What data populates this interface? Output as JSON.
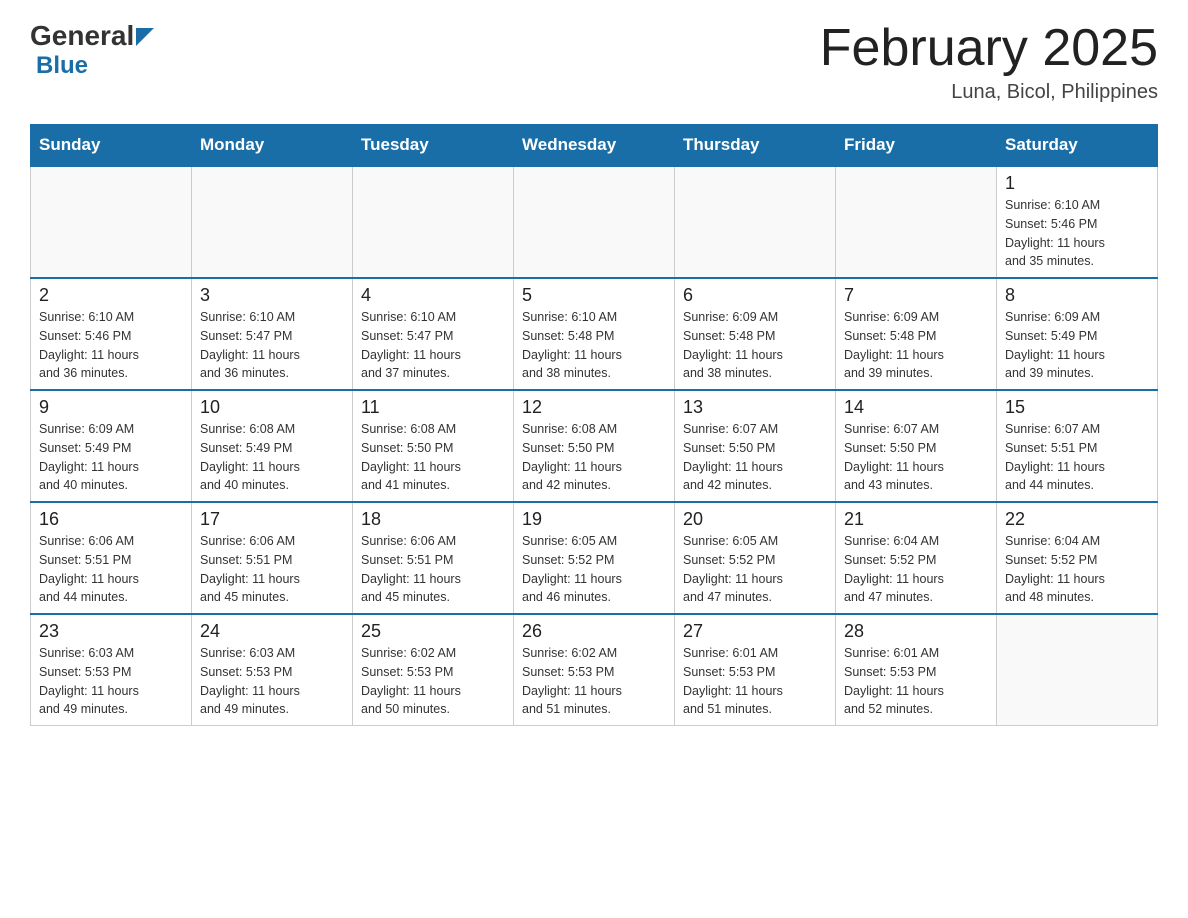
{
  "header": {
    "logo_general": "General",
    "logo_blue": "Blue",
    "title": "February 2025",
    "subtitle": "Luna, Bicol, Philippines"
  },
  "weekdays": [
    "Sunday",
    "Monday",
    "Tuesday",
    "Wednesday",
    "Thursday",
    "Friday",
    "Saturday"
  ],
  "weeks": [
    [
      {
        "day": "",
        "info": ""
      },
      {
        "day": "",
        "info": ""
      },
      {
        "day": "",
        "info": ""
      },
      {
        "day": "",
        "info": ""
      },
      {
        "day": "",
        "info": ""
      },
      {
        "day": "",
        "info": ""
      },
      {
        "day": "1",
        "info": "Sunrise: 6:10 AM\nSunset: 5:46 PM\nDaylight: 11 hours\nand 35 minutes."
      }
    ],
    [
      {
        "day": "2",
        "info": "Sunrise: 6:10 AM\nSunset: 5:46 PM\nDaylight: 11 hours\nand 36 minutes."
      },
      {
        "day": "3",
        "info": "Sunrise: 6:10 AM\nSunset: 5:47 PM\nDaylight: 11 hours\nand 36 minutes."
      },
      {
        "day": "4",
        "info": "Sunrise: 6:10 AM\nSunset: 5:47 PM\nDaylight: 11 hours\nand 37 minutes."
      },
      {
        "day": "5",
        "info": "Sunrise: 6:10 AM\nSunset: 5:48 PM\nDaylight: 11 hours\nand 38 minutes."
      },
      {
        "day": "6",
        "info": "Sunrise: 6:09 AM\nSunset: 5:48 PM\nDaylight: 11 hours\nand 38 minutes."
      },
      {
        "day": "7",
        "info": "Sunrise: 6:09 AM\nSunset: 5:48 PM\nDaylight: 11 hours\nand 39 minutes."
      },
      {
        "day": "8",
        "info": "Sunrise: 6:09 AM\nSunset: 5:49 PM\nDaylight: 11 hours\nand 39 minutes."
      }
    ],
    [
      {
        "day": "9",
        "info": "Sunrise: 6:09 AM\nSunset: 5:49 PM\nDaylight: 11 hours\nand 40 minutes."
      },
      {
        "day": "10",
        "info": "Sunrise: 6:08 AM\nSunset: 5:49 PM\nDaylight: 11 hours\nand 40 minutes."
      },
      {
        "day": "11",
        "info": "Sunrise: 6:08 AM\nSunset: 5:50 PM\nDaylight: 11 hours\nand 41 minutes."
      },
      {
        "day": "12",
        "info": "Sunrise: 6:08 AM\nSunset: 5:50 PM\nDaylight: 11 hours\nand 42 minutes."
      },
      {
        "day": "13",
        "info": "Sunrise: 6:07 AM\nSunset: 5:50 PM\nDaylight: 11 hours\nand 42 minutes."
      },
      {
        "day": "14",
        "info": "Sunrise: 6:07 AM\nSunset: 5:50 PM\nDaylight: 11 hours\nand 43 minutes."
      },
      {
        "day": "15",
        "info": "Sunrise: 6:07 AM\nSunset: 5:51 PM\nDaylight: 11 hours\nand 44 minutes."
      }
    ],
    [
      {
        "day": "16",
        "info": "Sunrise: 6:06 AM\nSunset: 5:51 PM\nDaylight: 11 hours\nand 44 minutes."
      },
      {
        "day": "17",
        "info": "Sunrise: 6:06 AM\nSunset: 5:51 PM\nDaylight: 11 hours\nand 45 minutes."
      },
      {
        "day": "18",
        "info": "Sunrise: 6:06 AM\nSunset: 5:51 PM\nDaylight: 11 hours\nand 45 minutes."
      },
      {
        "day": "19",
        "info": "Sunrise: 6:05 AM\nSunset: 5:52 PM\nDaylight: 11 hours\nand 46 minutes."
      },
      {
        "day": "20",
        "info": "Sunrise: 6:05 AM\nSunset: 5:52 PM\nDaylight: 11 hours\nand 47 minutes."
      },
      {
        "day": "21",
        "info": "Sunrise: 6:04 AM\nSunset: 5:52 PM\nDaylight: 11 hours\nand 47 minutes."
      },
      {
        "day": "22",
        "info": "Sunrise: 6:04 AM\nSunset: 5:52 PM\nDaylight: 11 hours\nand 48 minutes."
      }
    ],
    [
      {
        "day": "23",
        "info": "Sunrise: 6:03 AM\nSunset: 5:53 PM\nDaylight: 11 hours\nand 49 minutes."
      },
      {
        "day": "24",
        "info": "Sunrise: 6:03 AM\nSunset: 5:53 PM\nDaylight: 11 hours\nand 49 minutes."
      },
      {
        "day": "25",
        "info": "Sunrise: 6:02 AM\nSunset: 5:53 PM\nDaylight: 11 hours\nand 50 minutes."
      },
      {
        "day": "26",
        "info": "Sunrise: 6:02 AM\nSunset: 5:53 PM\nDaylight: 11 hours\nand 51 minutes."
      },
      {
        "day": "27",
        "info": "Sunrise: 6:01 AM\nSunset: 5:53 PM\nDaylight: 11 hours\nand 51 minutes."
      },
      {
        "day": "28",
        "info": "Sunrise: 6:01 AM\nSunset: 5:53 PM\nDaylight: 11 hours\nand 52 minutes."
      },
      {
        "day": "",
        "info": ""
      }
    ]
  ]
}
